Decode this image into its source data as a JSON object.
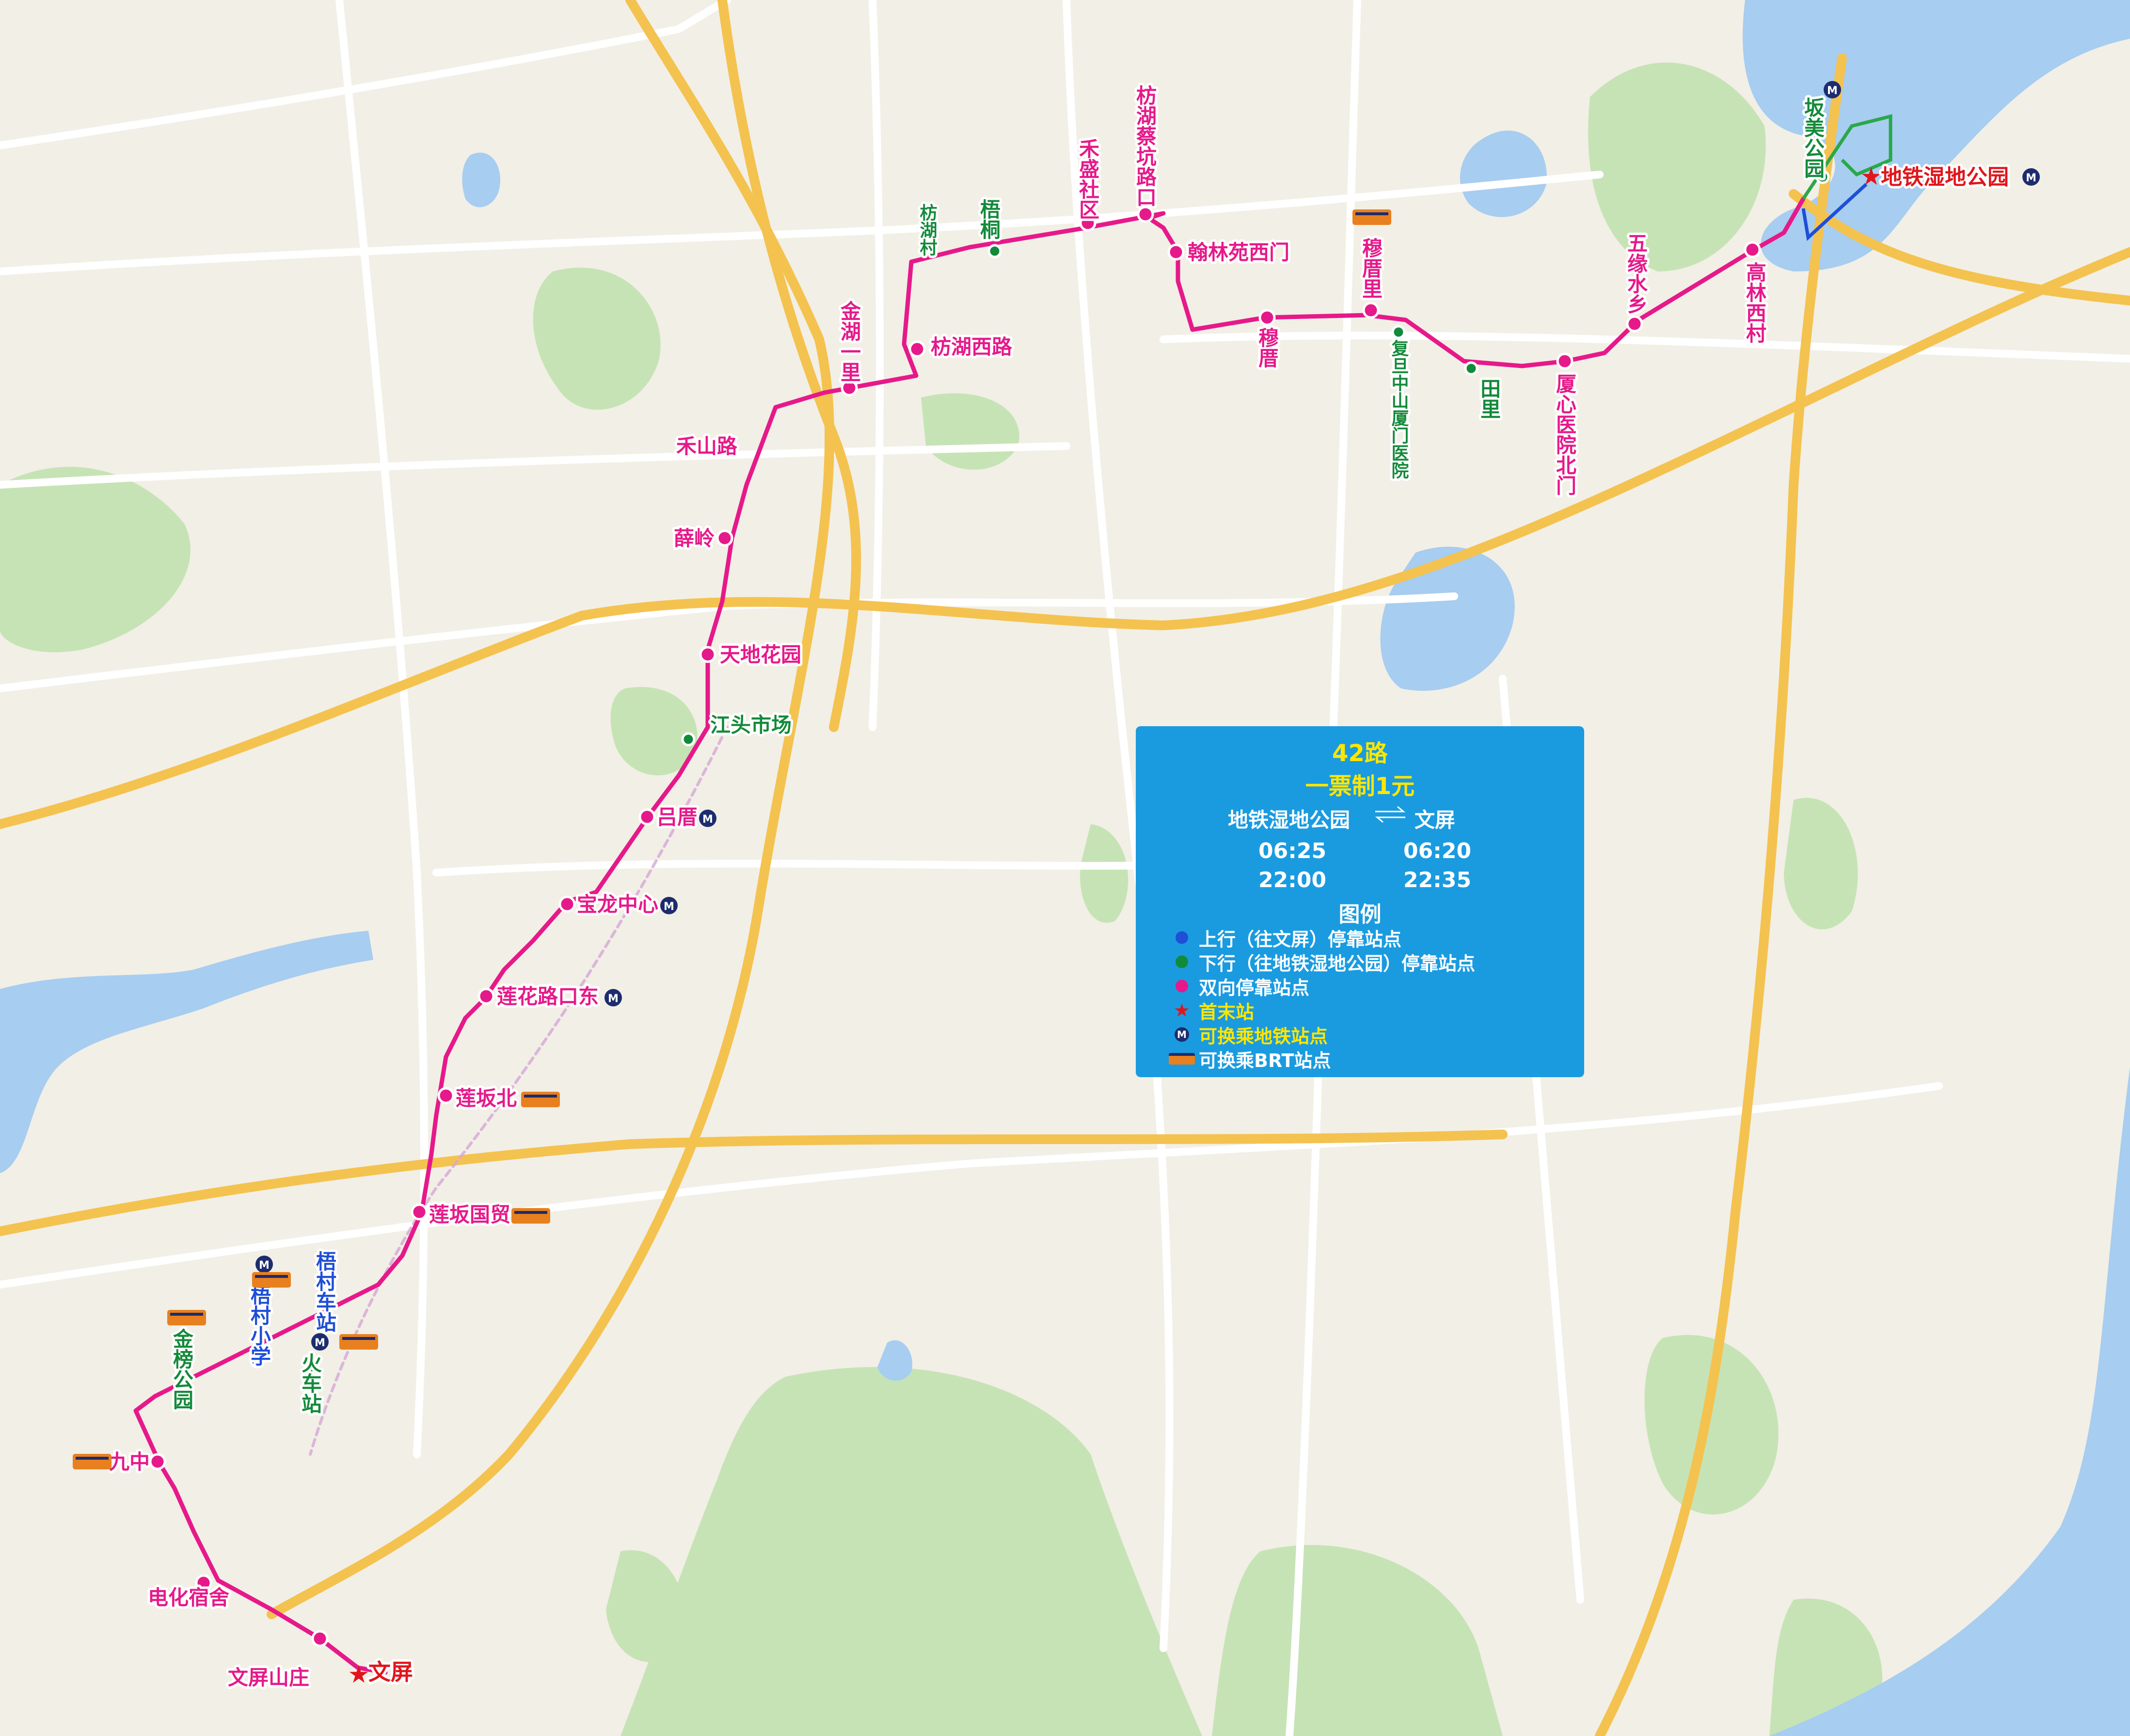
{
  "colors": {
    "route": "#e6198a",
    "up_stop": "#1f4fd6",
    "down_stop": "#138a3a",
    "both_stop": "#e6198a",
    "terminal": "#e0151b",
    "panel": "#1a9be0",
    "panel_heading": "#ffe600",
    "metro_icon": "#1c2c6e",
    "brt_icon": "#e8801f",
    "water": "#a7cdf0",
    "park": "#c6e3b5",
    "expressway": "#f4c24f"
  },
  "route_info": {
    "name": "42路",
    "fare": "一票制1元",
    "from": "地铁湿地公园",
    "to": "文屏",
    "first_from": "06:25",
    "first_to": "06:20",
    "last_from": "22:00",
    "last_to": "22:35"
  },
  "legend": {
    "title": "图例",
    "items": [
      {
        "icon": "blue-dot-icon",
        "label": "上行（往文屏）停靠站点",
        "color": "#ffffff"
      },
      {
        "icon": "green-dot-icon",
        "label": "下行（往地铁湿地公园）停靠站点",
        "color": "#ffffff"
      },
      {
        "icon": "magenta-dot-icon",
        "label": "双向停靠站点",
        "color": "#ffffff"
      },
      {
        "icon": "red-star-icon",
        "label": "首末站",
        "color": "#ffe600"
      },
      {
        "icon": "metro-icon",
        "label": "可换乘地铁站点",
        "color": "#ffe600"
      },
      {
        "icon": "brt-icon",
        "label": "可换乘BRT站点",
        "color": "#ffffff"
      }
    ]
  },
  "stops": [
    {
      "name": "地铁湿地公园",
      "type": "terminal",
      "metro": true
    },
    {
      "name": "坂美公园",
      "type": "down"
    },
    {
      "name": "高林西村",
      "type": "both"
    },
    {
      "name": "五缘水乡",
      "type": "both"
    },
    {
      "name": "厦心医院北门",
      "type": "both"
    },
    {
      "name": "田里",
      "type": "down"
    },
    {
      "name": "复旦中山厦门医院",
      "type": "down"
    },
    {
      "name": "穆厝里",
      "type": "both",
      "brt": true
    },
    {
      "name": "穆厝",
      "type": "both"
    },
    {
      "name": "翰林苑西门",
      "type": "both"
    },
    {
      "name": "枋湖蔡坑路口",
      "type": "both"
    },
    {
      "name": "禾盛社区",
      "type": "both"
    },
    {
      "name": "梧桐",
      "type": "down"
    },
    {
      "name": "枋湖村",
      "type": "down"
    },
    {
      "name": "枋湖西路",
      "type": "both"
    },
    {
      "name": "金湖一里",
      "type": "both"
    },
    {
      "name": "禾山路",
      "type": "both"
    },
    {
      "name": "薛岭",
      "type": "both"
    },
    {
      "name": "天地花园",
      "type": "both"
    },
    {
      "name": "江头市场",
      "type": "down"
    },
    {
      "name": "吕厝",
      "type": "both",
      "metro": true
    },
    {
      "name": "宝龙中心",
      "type": "both",
      "metro": true
    },
    {
      "name": "莲花路口东",
      "type": "both",
      "metro": true
    },
    {
      "name": "莲坂北",
      "type": "both",
      "brt": true
    },
    {
      "name": "莲坂国贸",
      "type": "both",
      "brt": true
    },
    {
      "name": "梧村车站",
      "type": "up"
    },
    {
      "name": "火车站",
      "type": "down",
      "metro": true,
      "brt": true
    },
    {
      "name": "梧村小学",
      "type": "up",
      "metro": true,
      "brt": true
    },
    {
      "name": "金榜公园",
      "type": "down",
      "brt": true
    },
    {
      "name": "九中",
      "type": "both",
      "brt": true
    },
    {
      "name": "电化宿舍",
      "type": "both"
    },
    {
      "name": "文屏山庄",
      "type": "both"
    },
    {
      "name": "文屏",
      "type": "terminal"
    }
  ]
}
